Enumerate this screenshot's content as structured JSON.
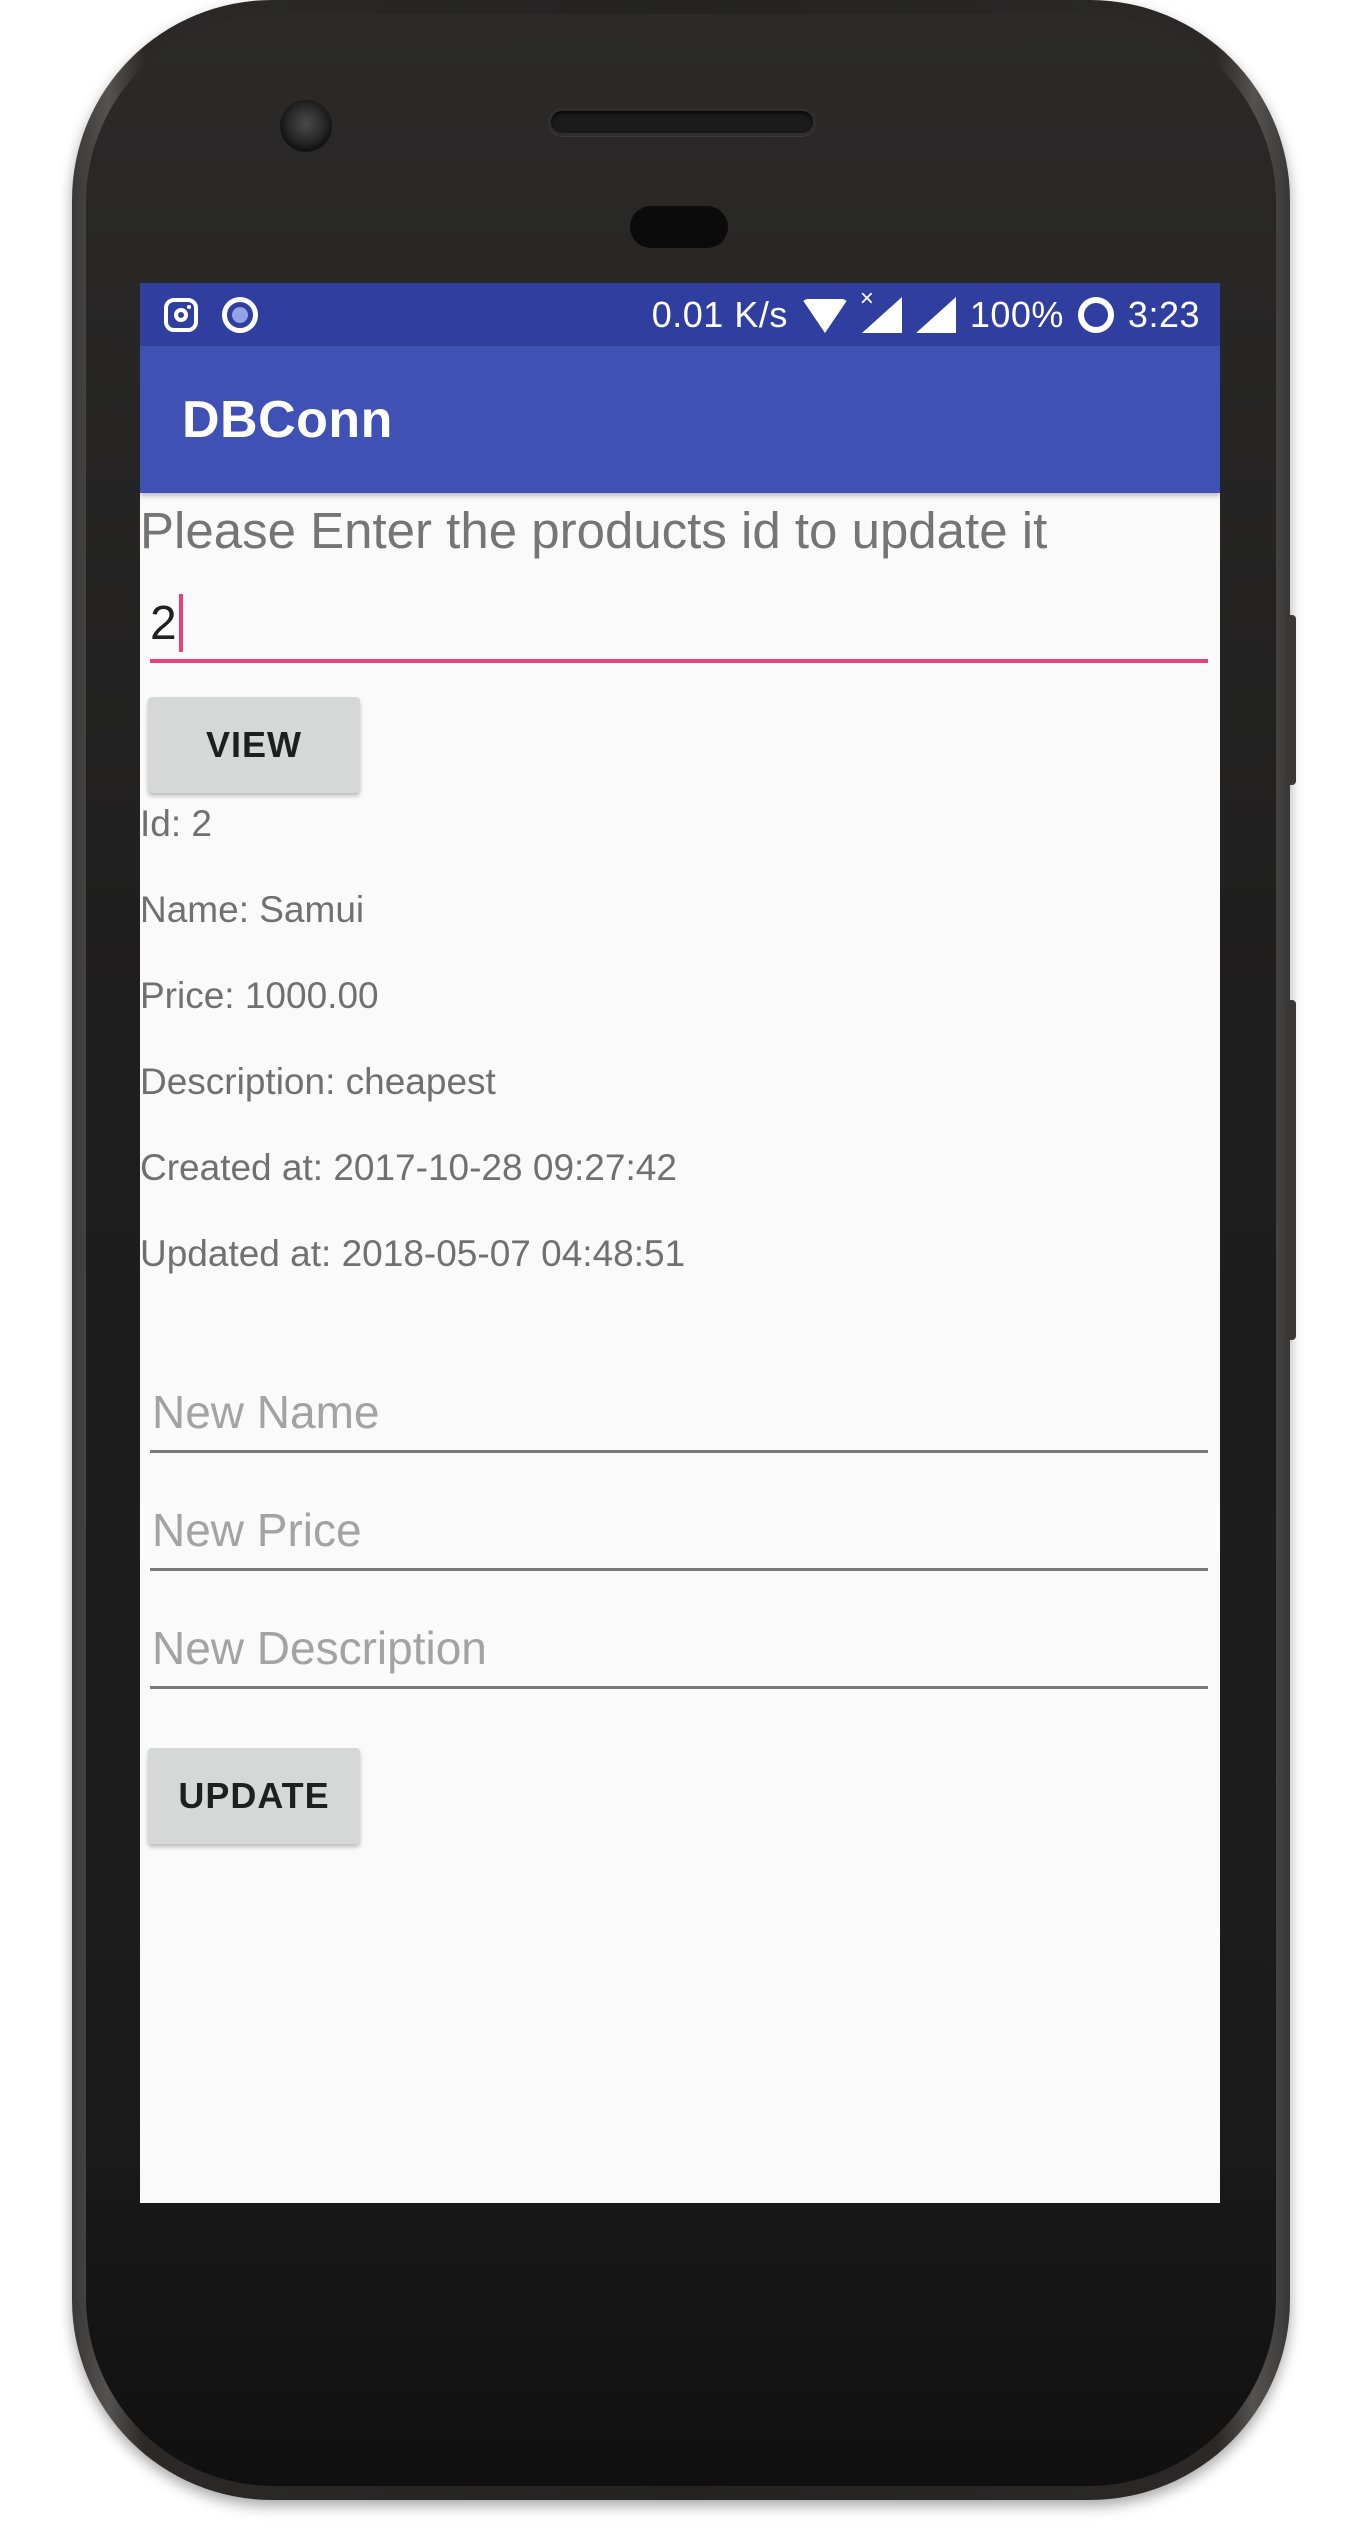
{
  "status_bar": {
    "left_icons": [
      "instagram-icon",
      "notification-circle-icon"
    ],
    "network_speed": "0.01 K/s",
    "icons": [
      "wifi-icon",
      "signal-off-icon",
      "signal-icon",
      "battery-ring-icon"
    ],
    "battery": "100%",
    "time": "3:23",
    "color": "#303f9f"
  },
  "app_bar": {
    "title": "DBConn",
    "color": "#3f51b5"
  },
  "main": {
    "prompt": "Please Enter the products id to update it",
    "id_input": {
      "value": "2",
      "accent": "#e8427c"
    },
    "view_button": "VIEW",
    "product": {
      "id": "Id: 2",
      "name": "Name: Samui",
      "price": "Price: 1000.00",
      "description": "Description: cheapest",
      "created_at": "Created at: 2017-10-28 09:27:42",
      "updated_at": "Updated at: 2018-05-07 04:48:51"
    },
    "new_name": {
      "value": "",
      "placeholder": "New Name"
    },
    "new_price": {
      "value": "",
      "placeholder": "New Price"
    },
    "new_description": {
      "value": "",
      "placeholder": "New Description"
    },
    "update_button": "UPDATE"
  }
}
